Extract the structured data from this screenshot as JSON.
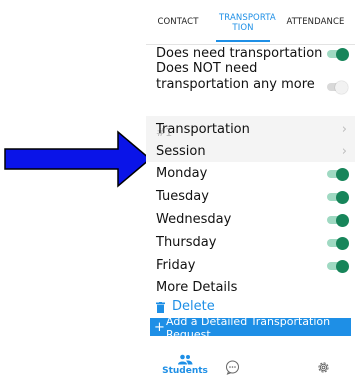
{
  "tabs": [
    {
      "label": "CONTACT"
    },
    {
      "label": "TRANSPORTA TION"
    },
    {
      "label": "ATTENDANCE"
    }
  ],
  "active_tab": "TRANSPORTA TION",
  "top_options": [
    {
      "label": "Does need transportation",
      "toggle": "on"
    },
    {
      "label": "Does NOT need transportation any more",
      "toggle": "off"
    }
  ],
  "section_label": "#1",
  "nav_rows": [
    {
      "label": "Transportation"
    },
    {
      "label": "Session"
    }
  ],
  "days": [
    {
      "label": "Monday",
      "toggle": "on"
    },
    {
      "label": "Tuesday",
      "toggle": "on"
    },
    {
      "label": "Wednesday",
      "toggle": "on"
    },
    {
      "label": "Thursday",
      "toggle": "on"
    },
    {
      "label": "Friday",
      "toggle": "on"
    }
  ],
  "more_details": "More Details",
  "delete_label": "Delete",
  "add_button": {
    "plus": "+",
    "label": "Add a Detailed Transportation Request"
  },
  "bottom_nav": {
    "students_label": "Students"
  },
  "colors": {
    "accent": "#1e8fe6",
    "toggle_on": "#17855a",
    "arrow": "#0a14e8"
  },
  "icons": [
    "chevron-right-icon",
    "trash-icon",
    "plus-icon",
    "students-icon",
    "chat-icon",
    "settings-icon",
    "arrow-annotation"
  ]
}
